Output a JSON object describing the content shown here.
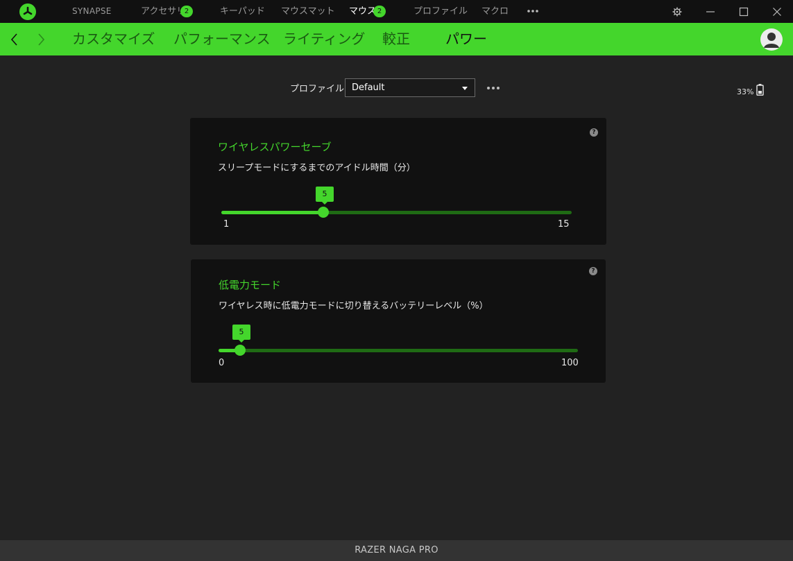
{
  "titlebar": {
    "logo_icon": "razer-logo-icon",
    "nav": [
      {
        "label": "SYNAPSE",
        "badge": null,
        "active": false
      },
      {
        "label": "アクセサリ",
        "badge": "2",
        "active": false
      },
      {
        "label": "キーパッド",
        "badge": null,
        "active": false
      },
      {
        "label": "マウスマット",
        "badge": null,
        "active": false
      },
      {
        "label": "マウス",
        "badge": "2",
        "active": true
      },
      {
        "label": "プロファイル",
        "badge": null,
        "active": false
      },
      {
        "label": "マクロ",
        "badge": null,
        "active": false
      }
    ],
    "more_icon": "more-horizontal-icon",
    "window_icons": [
      "gear-icon",
      "minimize-icon",
      "maximize-icon",
      "close-icon"
    ]
  },
  "subnav": {
    "tabs": [
      {
        "label": "カスタマイズ",
        "active": false
      },
      {
        "label": "パフォーマンス",
        "active": false
      },
      {
        "label": "ライティング",
        "active": false
      },
      {
        "label": "較正",
        "active": false
      },
      {
        "label": "パワー",
        "active": true
      }
    ],
    "back_icon": "chevron-left-icon",
    "forward_icon": "chevron-right-icon",
    "avatar_icon": "user-avatar-icon"
  },
  "profile": {
    "label": "プロファイル",
    "selected": "Default"
  },
  "battery": {
    "percent_label": "33%",
    "icon": "battery-icon"
  },
  "cards": [
    {
      "title": "ワイヤレスパワーセーブ",
      "description": "スリープモードにするまでのアイドル時間（分）",
      "help": "?",
      "slider": {
        "min": 1,
        "max": 15,
        "value": 5,
        "min_label": "1",
        "max_label": "15",
        "value_label": "5"
      }
    },
    {
      "title": "低電力モード",
      "description": "ワイヤレス時に低電力モードに切り替えるバッテリーレベル（%）",
      "help": "?",
      "slider": {
        "min": 0,
        "max": 100,
        "value": 5,
        "min_label": "0",
        "max_label": "100",
        "value_label": "5"
      }
    }
  ],
  "footer": {
    "device_name": "RAZER NAGA PRO"
  },
  "colors": {
    "accent": "#44d62c",
    "track_dim": "#1f6b14",
    "background": "#222222",
    "card": "#111111",
    "titlebar": "#111111"
  }
}
